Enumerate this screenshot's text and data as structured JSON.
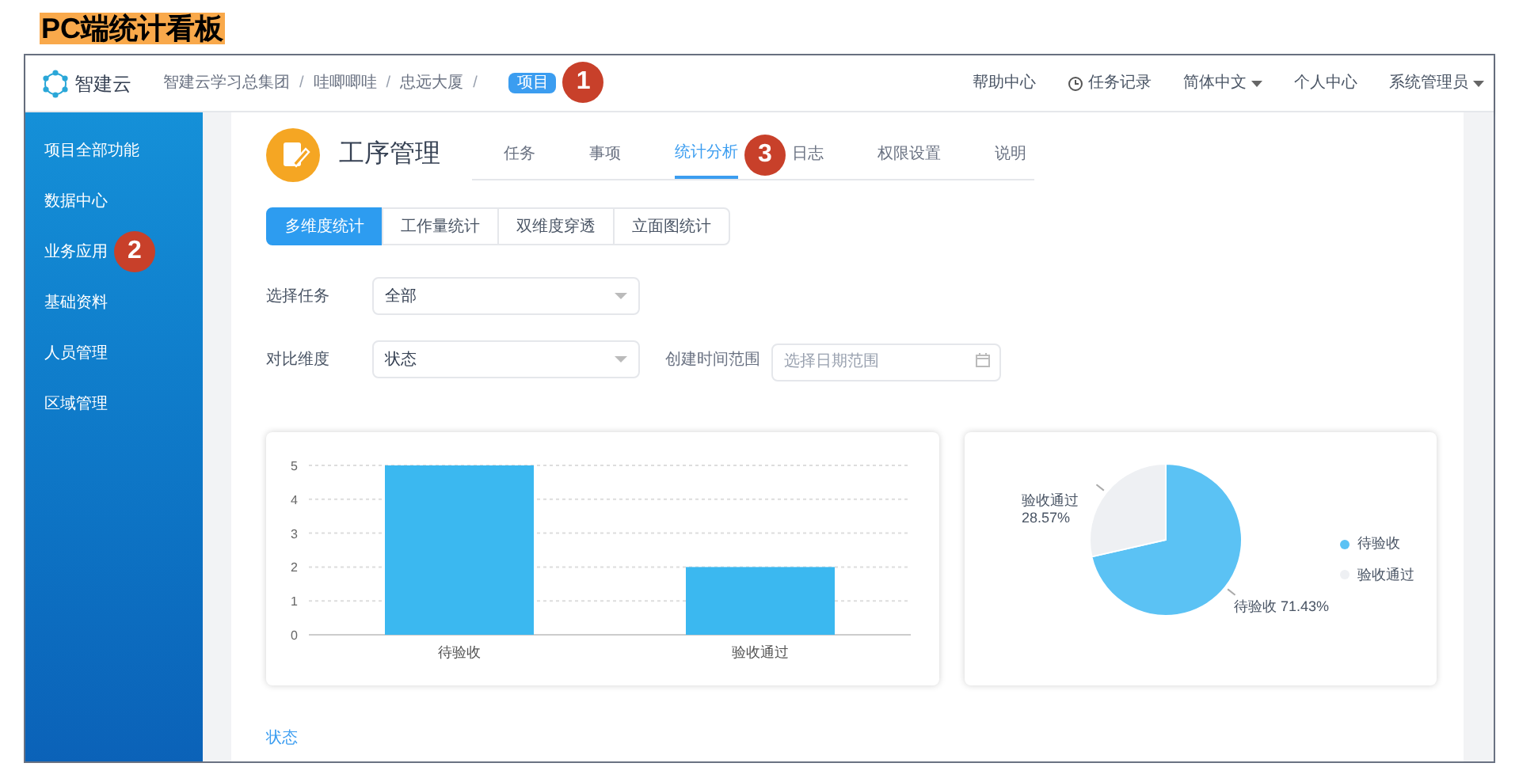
{
  "heading": "PC端统计看板",
  "header": {
    "logo": "智建云",
    "breadcrumb": [
      "智建云学习总集团",
      "哇唧唧哇",
      "忠远大厦"
    ],
    "separator": "/",
    "badge": {
      "label": "项目",
      "callout": "1"
    },
    "links": [
      {
        "label": "帮助中心",
        "kind": "plain"
      },
      {
        "label": "任务记录",
        "kind": "clock"
      },
      {
        "label": "简体中文",
        "kind": "dropdown"
      },
      {
        "label": "个人中心",
        "kind": "plain"
      },
      {
        "label": "系统管理员",
        "kind": "dropdown"
      }
    ]
  },
  "sidebar": {
    "items": [
      {
        "label": "项目全部功能"
      },
      {
        "label": "数据中心"
      },
      {
        "label": "业务应用",
        "callout": "2"
      },
      {
        "label": "基础资料"
      },
      {
        "label": "人员管理"
      },
      {
        "label": "区域管理"
      }
    ]
  },
  "page": {
    "title": "工序管理",
    "tabs": [
      {
        "label": "任务",
        "selected": false
      },
      {
        "label": "事项",
        "selected": false
      },
      {
        "label": "统计分析",
        "selected": true,
        "callout": "3"
      },
      {
        "label": "日志",
        "selected": false
      },
      {
        "label": "权限设置",
        "selected": false
      },
      {
        "label": "说明",
        "selected": false
      }
    ],
    "segments": [
      {
        "label": "多维度统计",
        "selected": true
      },
      {
        "label": "工作量统计",
        "selected": false
      },
      {
        "label": "双维度穿透",
        "selected": false
      },
      {
        "label": "立面图统计",
        "selected": false
      }
    ],
    "filters": [
      {
        "label": "选择任务",
        "value": "全部"
      },
      {
        "label": "对比维度",
        "value": "状态"
      }
    ],
    "date_range": {
      "label": "创建时间范围",
      "placeholder": "选择日期范围"
    },
    "bar_card": {
      "chart_data": {
        "type": "bar",
        "categories": [
          "待验收",
          "验收通过"
        ],
        "series": [
          {
            "color": "#3bb8f0",
            "values": [
              5,
              2
            ]
          }
        ],
        "ylim": [
          0,
          5
        ],
        "yticks": [
          0,
          1,
          2,
          3,
          4,
          5
        ],
        "grid": true
      }
    },
    "pie_card": {
      "chart_data": {
        "type": "pie",
        "categories": [
          "待验收",
          "验收通过"
        ],
        "values": [
          71.43,
          28.57
        ],
        "value_labels": [
          "待验收 71.43%",
          "验收通过 28.57%"
        ]
      },
      "legend": [
        {
          "color": "#5bc2f4"
        },
        {
          "color": "#eef0f3"
        }
      ]
    },
    "footer_link": "状态"
  }
}
